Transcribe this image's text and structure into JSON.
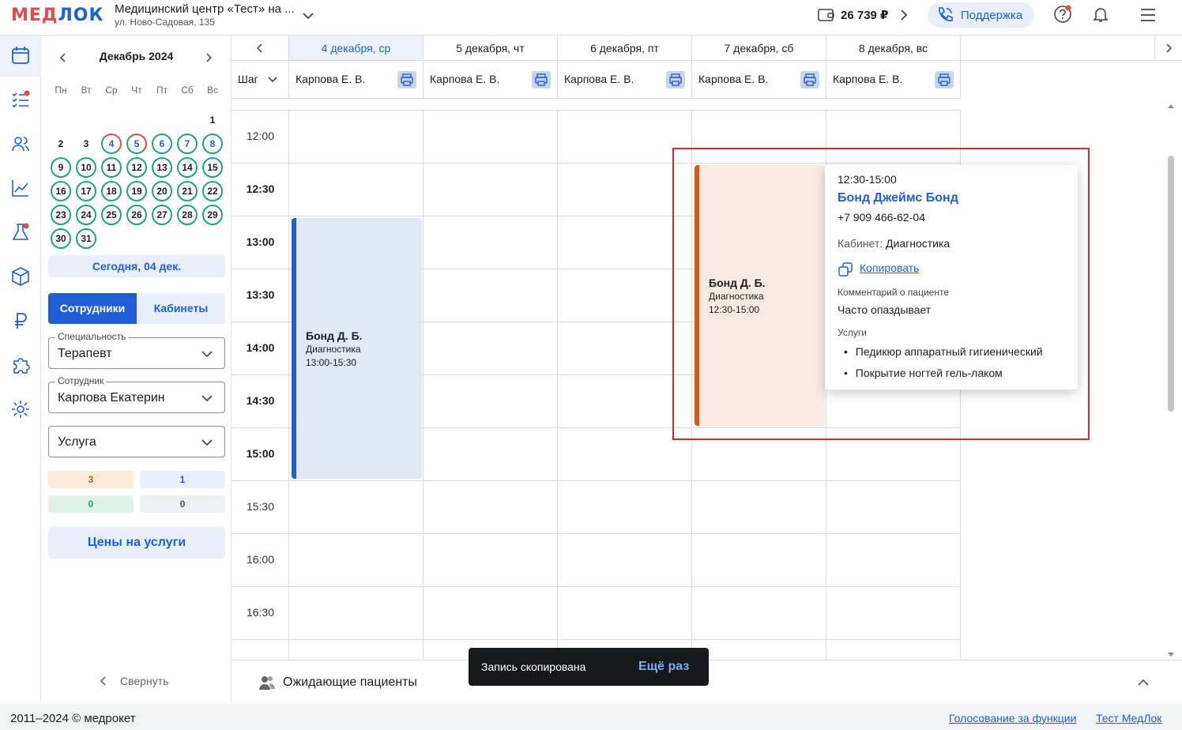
{
  "header": {
    "logo_left": "МЕД",
    "logo_right": "ЛОК",
    "clinic_name": "Медицинский центр «Тест» на ...",
    "clinic_address": "ул. Ново-Садовая, 135",
    "balance": "26 739 ₽",
    "support_label": "Поддержка",
    "icons": [
      "wallet-icon",
      "phone-icon",
      "help-icon",
      "bell-icon",
      "menu-icon"
    ]
  },
  "nav": {
    "icons": [
      "calendar-icon",
      "tasks-icon",
      "users-icon",
      "analytics-icon",
      "lab-flask-icon",
      "box-icon",
      "ruble-icon",
      "puzzle-icon",
      "settings-icon"
    ],
    "expand_icon": "chevron-right-icon"
  },
  "sidebar": {
    "month_title": "Декабрь 2024",
    "weekdays": [
      "Пн",
      "Вт",
      "Ср",
      "Чт",
      "Пт",
      "Сб",
      "Вс"
    ],
    "days": [
      "1",
      "2",
      "3",
      "4",
      "5",
      "6",
      "7",
      "8",
      "9",
      "10",
      "11",
      "12",
      "13",
      "14",
      "15",
      "16",
      "17",
      "18",
      "19",
      "20",
      "21",
      "22",
      "23",
      "24",
      "25",
      "26",
      "27",
      "28",
      "29",
      "30",
      "31"
    ],
    "today_button": "Сегодня, 04 дек.",
    "tabs": [
      "Сотрудники",
      "Кабинеты"
    ],
    "specialty_label": "Специальность",
    "specialty_value": "Терапевт",
    "employee_label": "Сотрудник",
    "employee_value": "Карпова Екатерин",
    "service_value": "Услуга",
    "counters": [
      "3",
      "1",
      "0",
      "0"
    ],
    "prices_button": "Цены на услуги",
    "collapse_label": "Свернуть"
  },
  "schedule": {
    "days": [
      "4 декабря, ср",
      "5 декабря, чт",
      "6 декабря, пт",
      "7 декабря, сб",
      "8 декабря, вс"
    ],
    "step_label": "Шаг",
    "employee": "Карпова Е. В.",
    "times": [
      "12:00",
      "12:30",
      "13:00",
      "13:30",
      "14:00",
      "14:30",
      "15:00",
      "15:30",
      "16:00",
      "16:30"
    ],
    "appointments": [
      {
        "name": "Бонд Д. Б.",
        "service": "Диагностика",
        "time": "13:00-15:30"
      },
      {
        "name": "Бонд Д. Б.",
        "service": "Диагностика",
        "time": "12:30-15:00"
      }
    ]
  },
  "popup": {
    "time": "12:30-15:00",
    "patient": "Бонд Джеймс Бонд",
    "phone": "+7 909 466-62-04",
    "room_label": "Кабинет:",
    "room_value": "Диагностика",
    "copy_label": "Копировать",
    "comment_label": "Комментарий о пациенте",
    "comment": "Часто опаздывает",
    "services_label": "Услуги",
    "services": [
      "Педикюр аппаратный гигиенический",
      "Покрытие ногтей гель-лаком"
    ]
  },
  "waiting": {
    "label": "Ожидающие пациенты"
  },
  "toast": {
    "message": "Запись скопирована",
    "action": "Ещё раз"
  },
  "footer": {
    "copyright": "2011–2024 © медрокет",
    "link1": "Голосование за функции",
    "link2": "Тест МедЛок"
  },
  "colors": {
    "accent": "#1f5fd6",
    "green": "#1ea672",
    "red": "#e5484d",
    "orange": "#e0560f"
  }
}
